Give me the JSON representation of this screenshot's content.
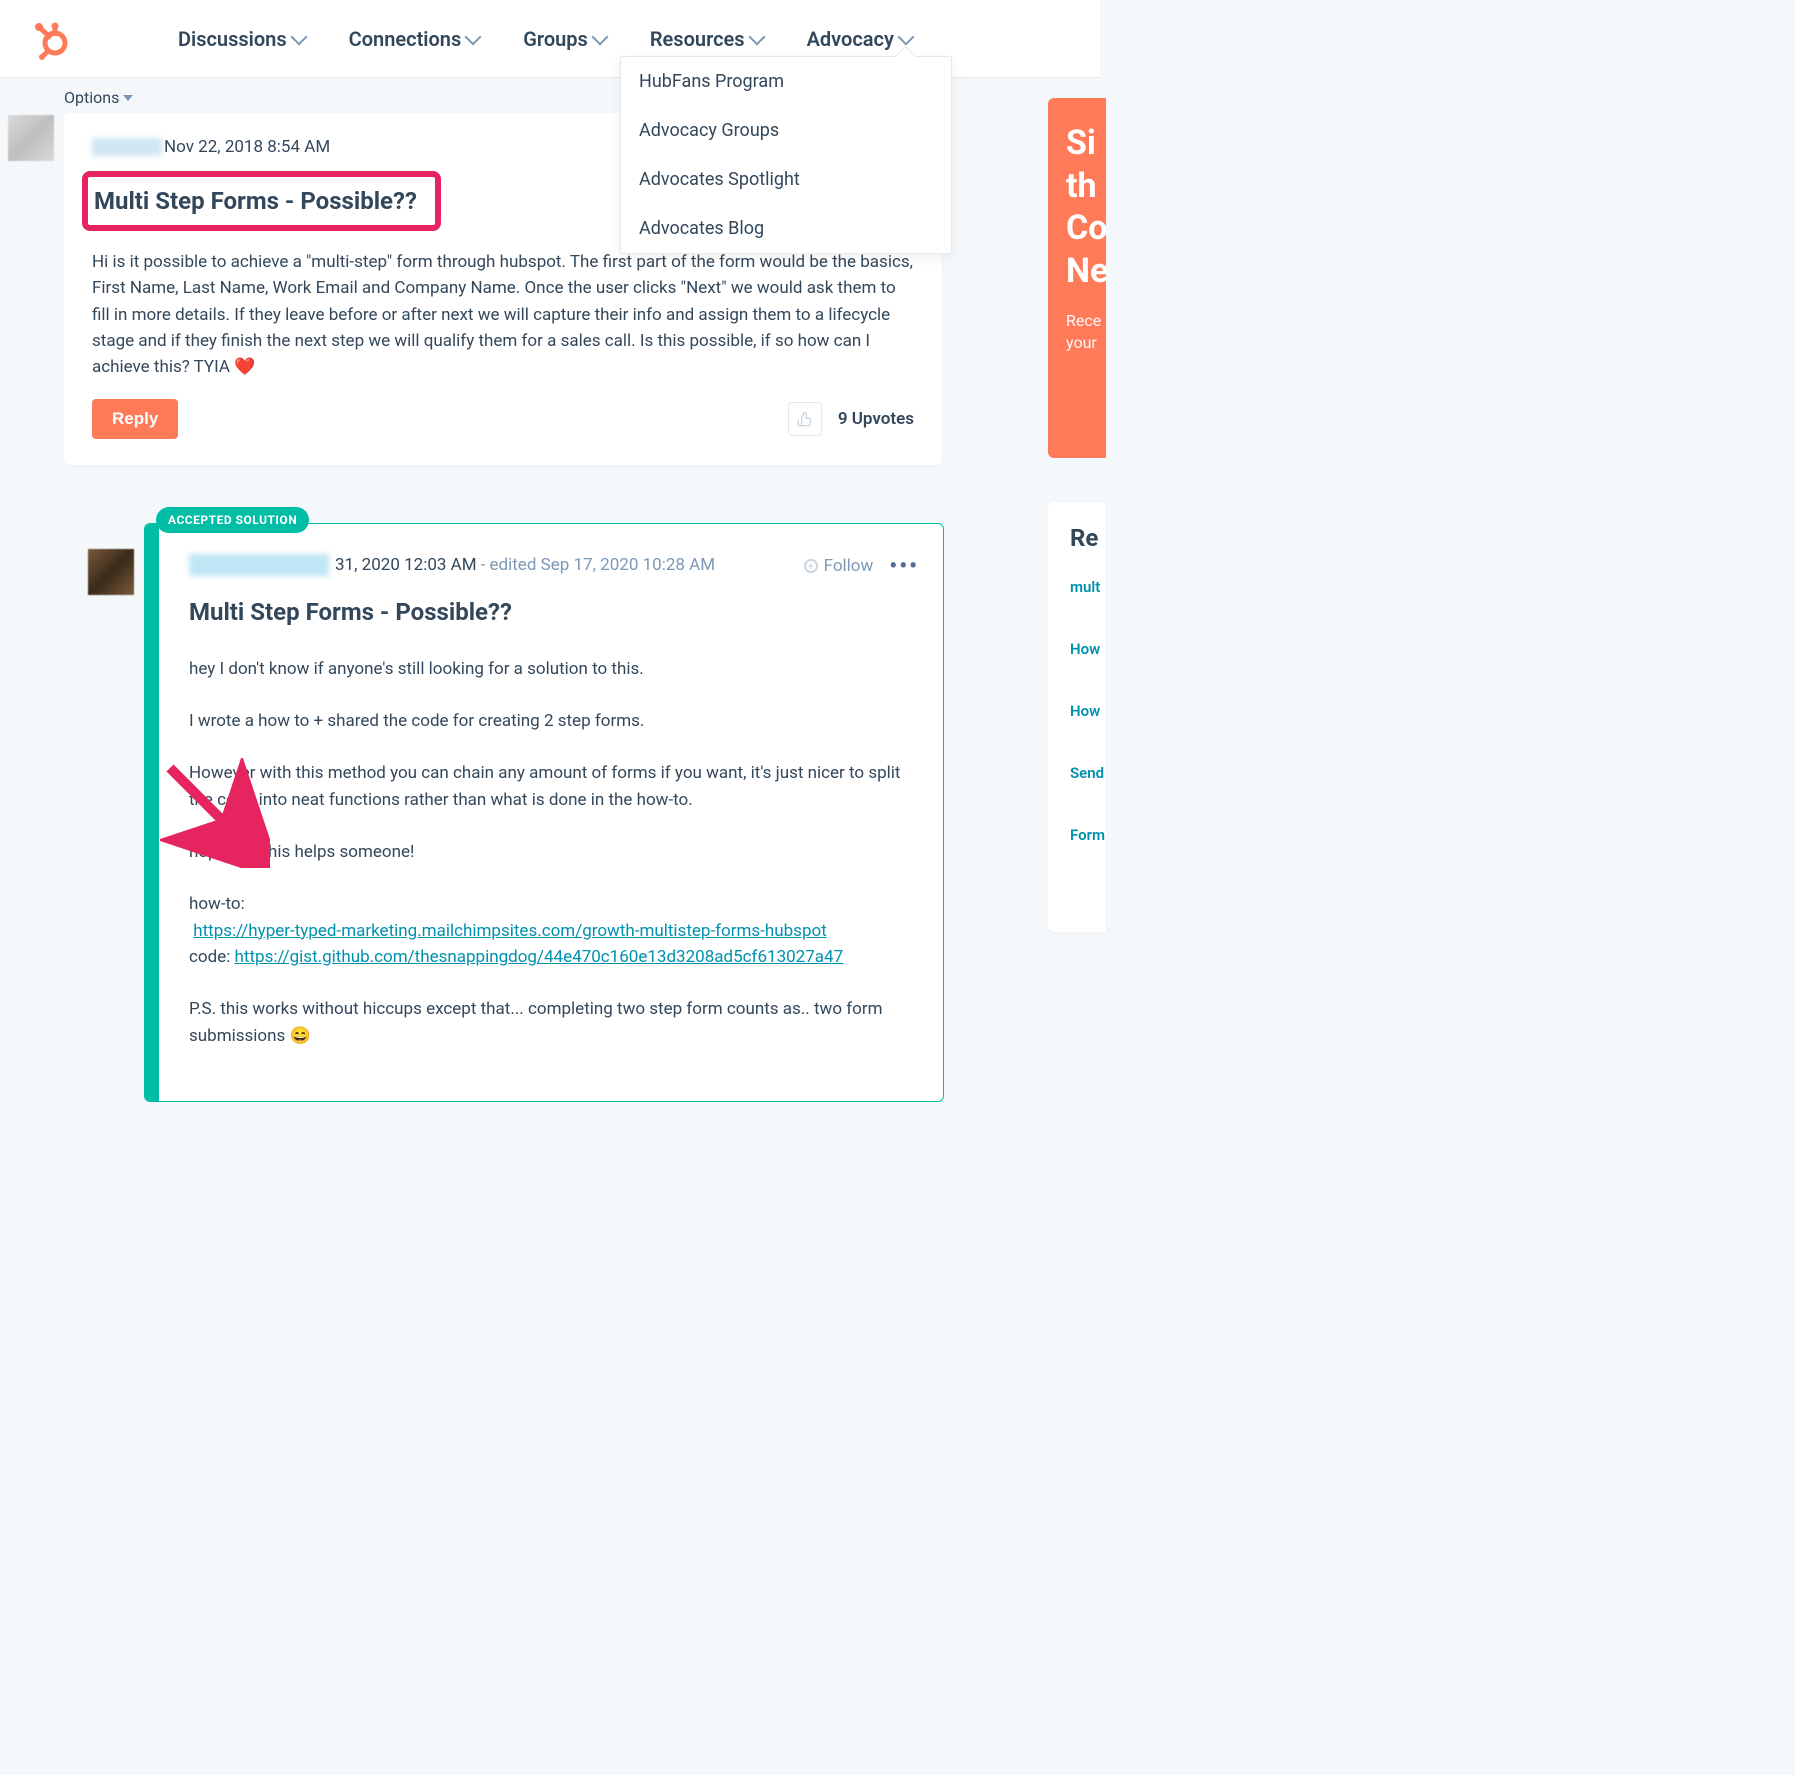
{
  "nav": {
    "items": [
      {
        "label": "Discussions"
      },
      {
        "label": "Connections"
      },
      {
        "label": "Groups"
      },
      {
        "label": "Resources"
      },
      {
        "label": "Advocacy"
      }
    ],
    "dropdown": [
      "HubFans Program",
      "Advocacy Groups",
      "Advocates Spotlight",
      "Advocates Blog"
    ]
  },
  "options_label": "Options",
  "post": {
    "date": "Nov 22, 2018 8:54 AM",
    "title": "Multi Step Forms - Possible??",
    "body": "Hi is it possible to achieve a \"multi-step\" form through hubspot. The first part of the form would be the basics, First Name, Last Name, Work Email and Company Name. Once the user clicks \"Next\" we would ask them to fill in more details. If they leave before or after next we will capture their info and assign them to a lifecycle stage and if they finish the next step we will qualify them for a sales call. Is this possible, if so how can I achieve this? TYIA ❤️",
    "reply_label": "Reply",
    "upvotes": "9 Upvotes"
  },
  "solution": {
    "badge": "ACCEPTED SOLUTION",
    "date_frag": "31, 2020 12:03 AM",
    "edited": " - edited Sep 17, 2020 10:28 AM",
    "follow": "Follow",
    "title": "Multi Step Forms - Possible??",
    "p1": "hey I don't know if anyone's still looking for a solution to this.",
    "p2": "I wrote a how to + shared the code for creating 2 step forms.",
    "p3": "However with this method you can chain any amount of forms if you want, it's just nicer to split the code into neat functions rather than what is done in the how-to.",
    "p4": "hopefully this helps someone!",
    "howto_label": "how-to: ",
    "howto_link": "https://hyper-typed-marketing.mailchimpsites.com/growth-multistep-forms-hubspot",
    "code_label": "code: ",
    "code_link": "https://gist.github.com/thesnappingdog/44e470c160e13d3208ad5cf613027a47",
    "ps": "P.S. this works without hiccups except that... completing two step form counts as.. two form submissions 😄"
  },
  "sidebar": {
    "cta_lines": "Si\nth\nCo\nNe",
    "cta_sub": "Rece\nyour",
    "panel_title": "Re",
    "links": [
      "mult",
      "How",
      "How",
      "Send",
      "Form"
    ]
  }
}
